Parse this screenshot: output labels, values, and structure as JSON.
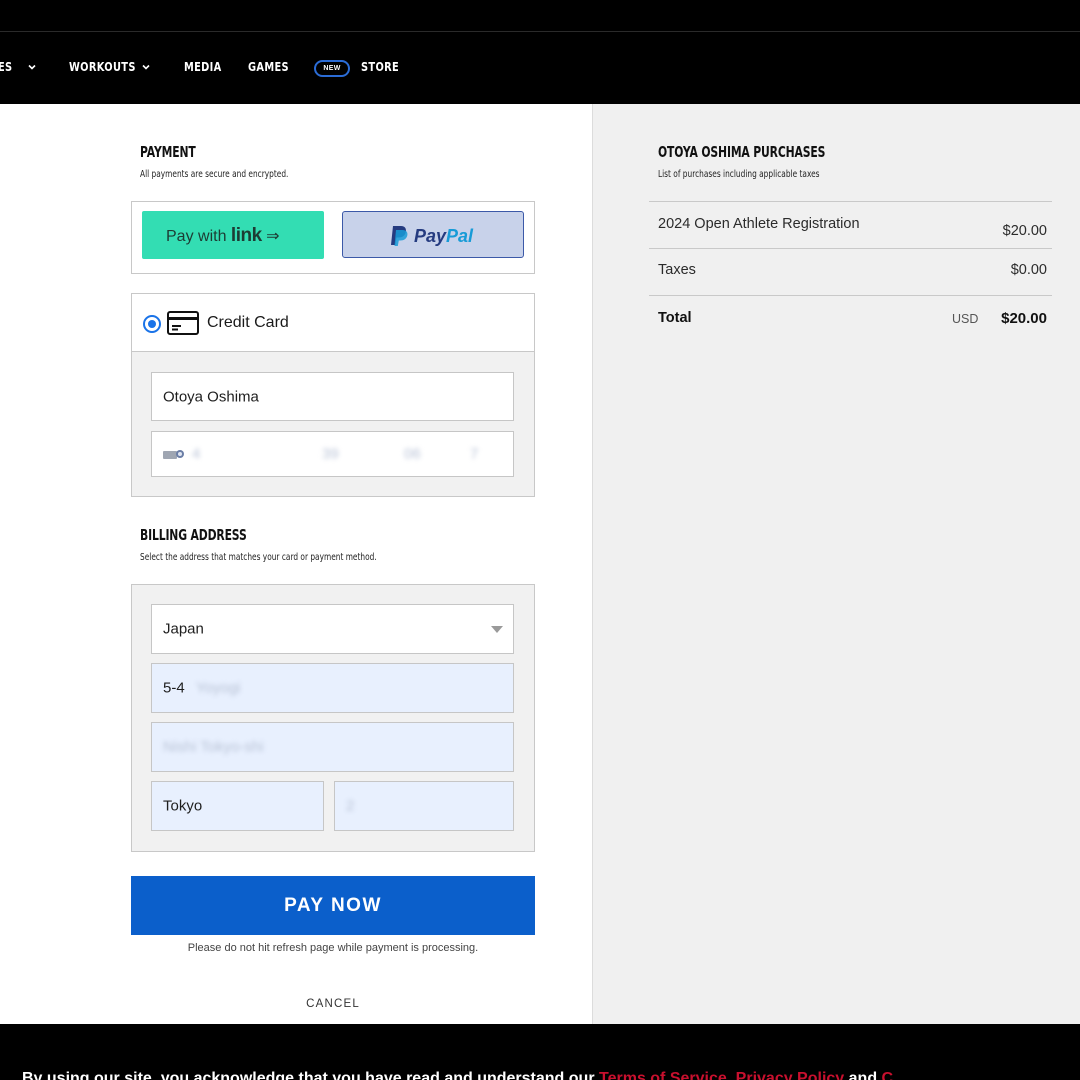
{
  "nav": {
    "items_partial": "ES",
    "workouts": "WORKOUTS",
    "media": "MEDIA",
    "games": "GAMES",
    "new_badge": "NEW",
    "store": "STORE"
  },
  "payment": {
    "heading": "PAYMENT",
    "subtext": "All payments are secure and encrypted.",
    "link_button": {
      "prefix": "Pay with",
      "brand": "link",
      "arrow": "⇒"
    },
    "paypal_button": {
      "part1": "Pay",
      "part2": "Pal"
    },
    "method_label": "Credit Card",
    "name_on_card": "Otoya Oshima",
    "card_number_partial": "4",
    "card_mid_partial": "39",
    "card_expiry_partial": "06",
    "card_cvc_partial": "7"
  },
  "billing": {
    "heading": "BILLING ADDRESS",
    "subtext": "Select the address that matches your card or payment method.",
    "country": "Japan",
    "address_line1_partial": "5-4",
    "address_line1_blurred": "Yoyogi",
    "address_line2_blurred": "Nishi Tokyo-shi",
    "city": "Tokyo",
    "postal_blurred": "2"
  },
  "actions": {
    "pay_now": "PAY NOW",
    "note": "Please do not hit refresh page while payment is processing.",
    "cancel": "CANCEL"
  },
  "summary": {
    "heading": "OTOYA OSHIMA PURCHASES",
    "subtext": "List of purchases including applicable taxes",
    "rows": [
      {
        "label": "2024 Open Athlete Registration",
        "value": "$20.00"
      },
      {
        "label": "Taxes",
        "value": "$0.00"
      }
    ],
    "total_label": "Total",
    "currency": "USD",
    "total_value": "$20.00"
  },
  "footer": {
    "text": "By using our site, you acknowledge that you have read and understand our",
    "link1": "Terms of Service",
    "sep": ",",
    "link2": "Privacy Policy",
    "and": "and",
    "link3": "C"
  },
  "colors": {
    "link_green": "#33ddb3",
    "paypal_bg": "#c8d2ea",
    "pay_button": "#0b5fcb",
    "footer_link": "#c8102e"
  }
}
